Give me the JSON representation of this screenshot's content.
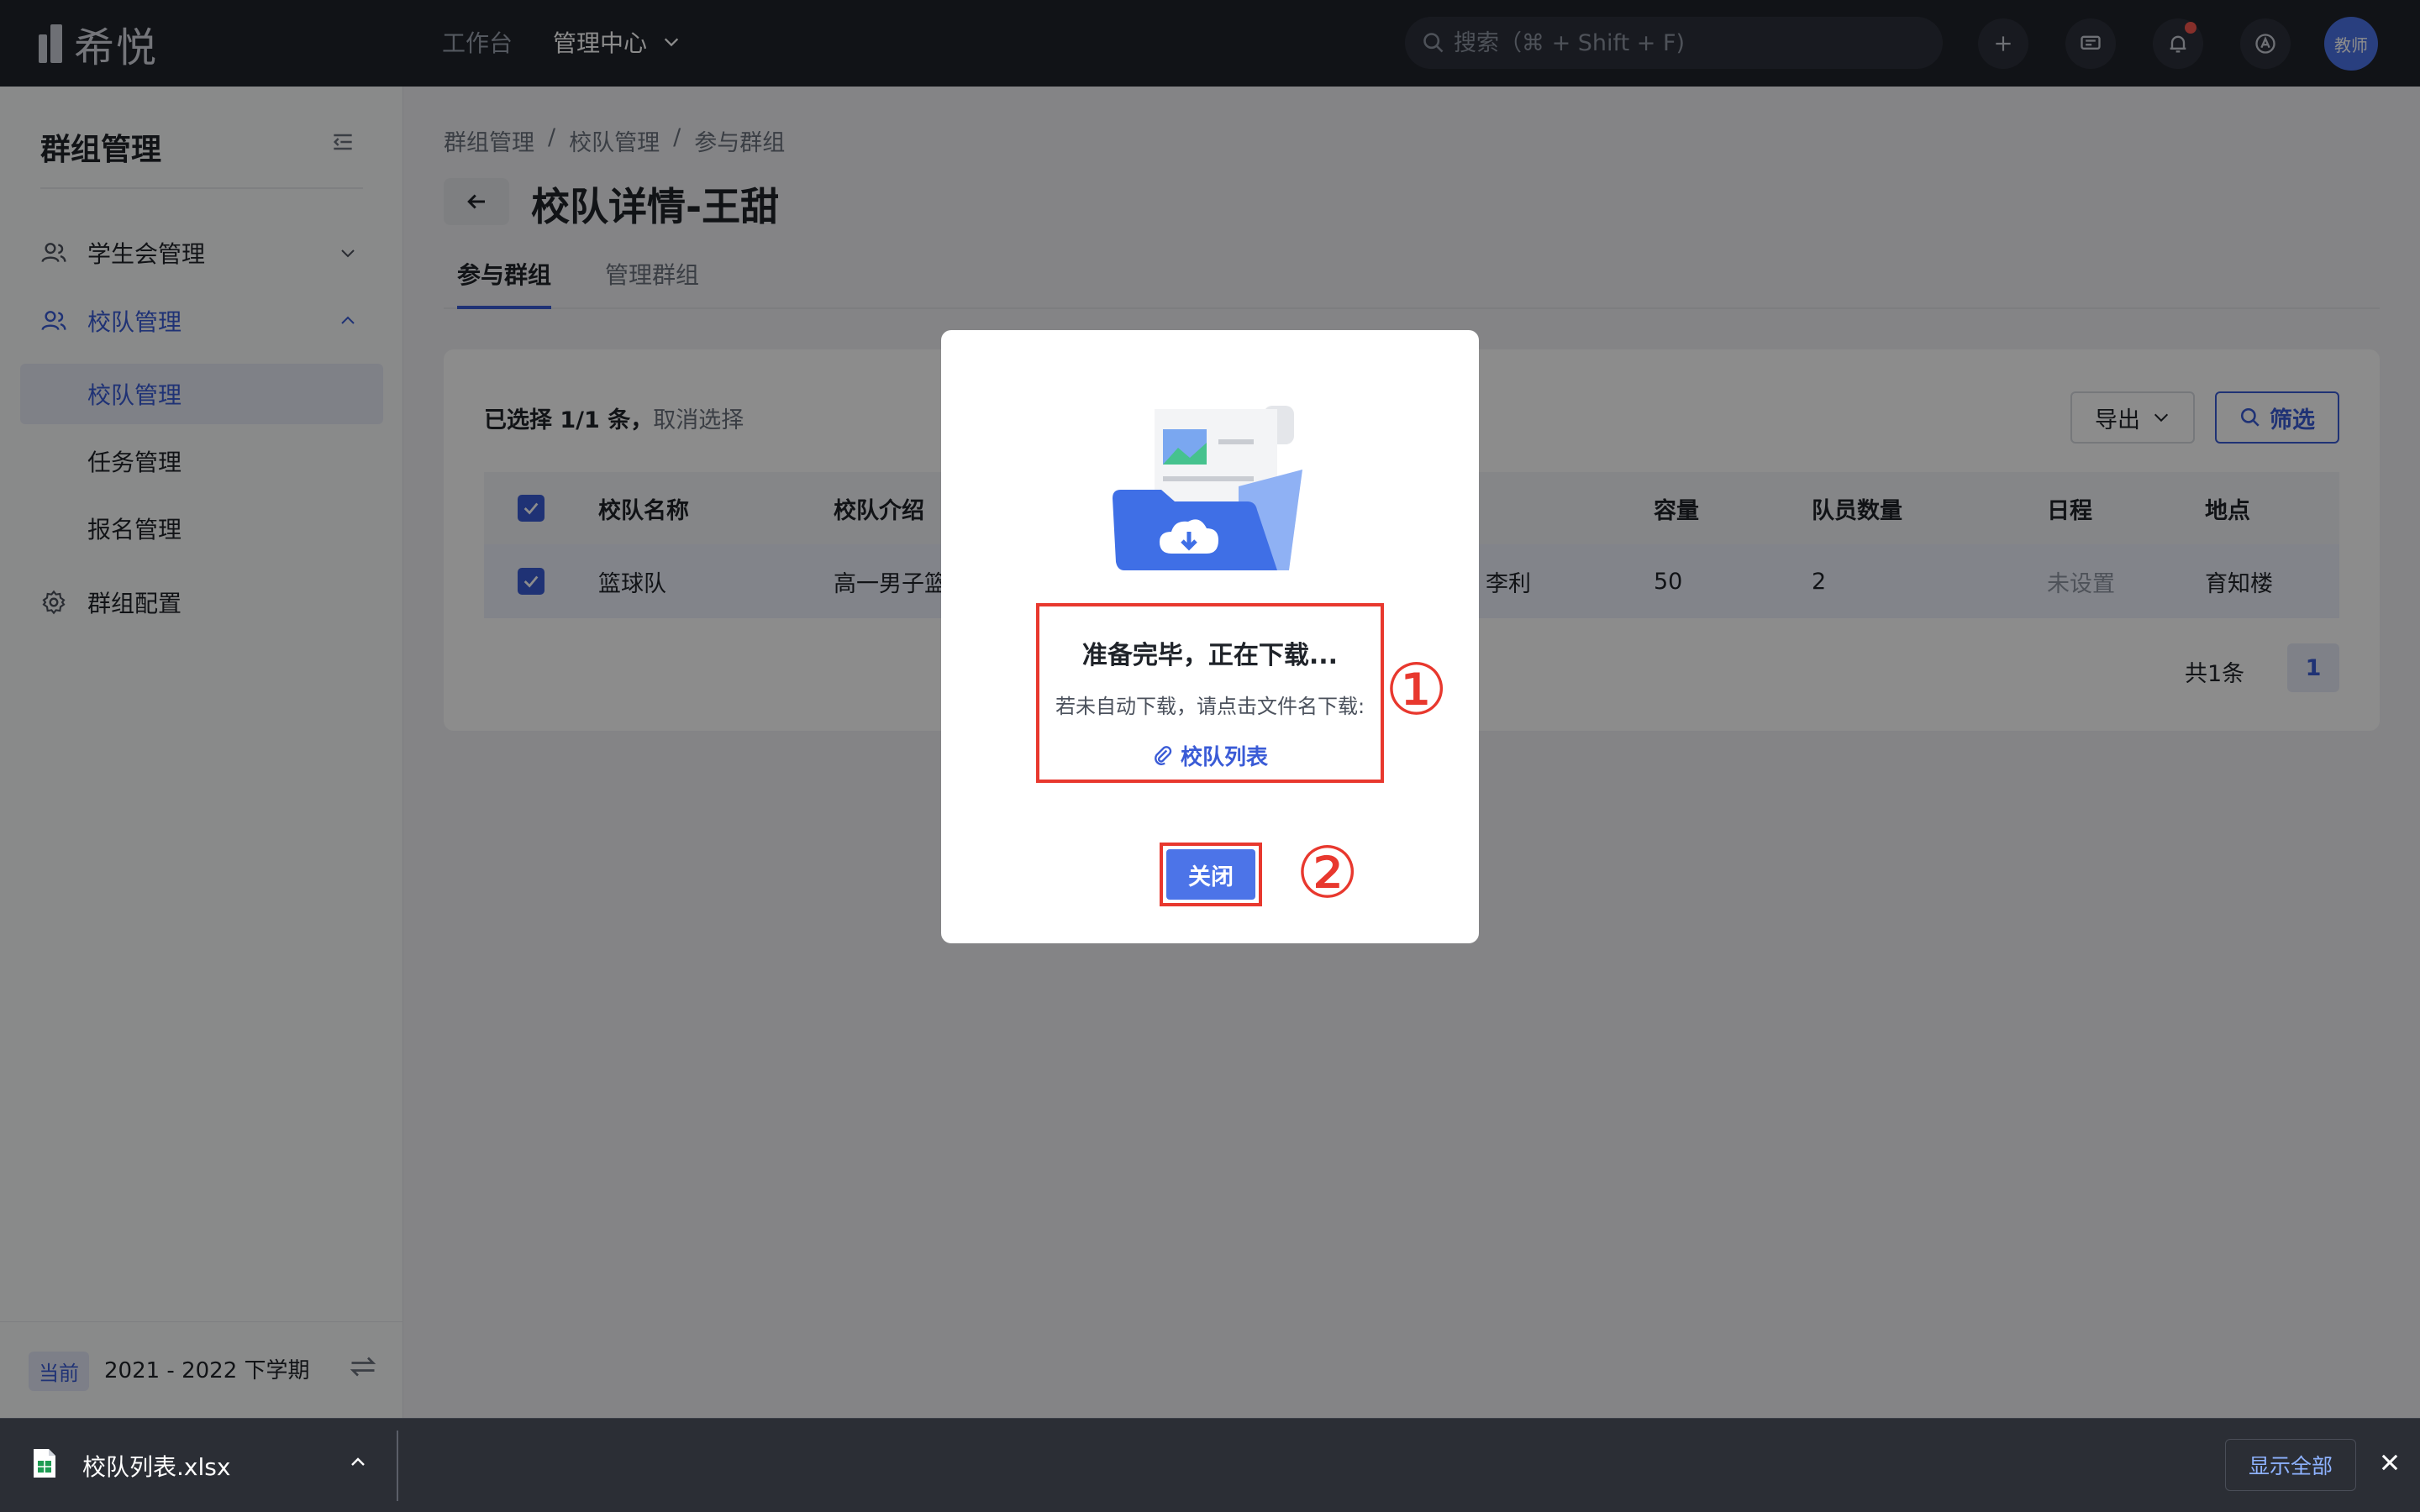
{
  "topbar": {
    "logo_text": "希悦",
    "nav": [
      {
        "label": "工作台"
      },
      {
        "label": "管理中心"
      }
    ],
    "search_placeholder": "搜索（⌘ + Shift + F)",
    "avatar_text": "教师",
    "icons": [
      "plus-icon",
      "message-icon",
      "bell-icon",
      "app-icon"
    ],
    "notification_dot_color": "#f5564e"
  },
  "sidebar": {
    "title": "群组管理",
    "groups": [
      {
        "label": "学生会管理",
        "expanded": false
      },
      {
        "label": "校队管理",
        "expanded": true
      },
      {
        "label": "群组配置"
      }
    ],
    "sub_items": [
      {
        "label": "校队管理",
        "active": true
      },
      {
        "label": "任务管理"
      },
      {
        "label": "报名管理"
      }
    ],
    "term_badge": "当前",
    "term_text": "2021 - 2022 下学期"
  },
  "main": {
    "breadcrumb": [
      "群组管理",
      "/",
      "校队管理",
      "/",
      "参与群组"
    ],
    "title": "校队详情-王甜",
    "tabs": [
      {
        "label": "参与群组",
        "active": true
      },
      {
        "label": "管理群组"
      }
    ],
    "selection_text": "已选择 1/1 条，",
    "cancel_selection": "取消选择",
    "export_label": "导出",
    "filter_label": "筛选",
    "table": {
      "headers": [
        "校队名称",
        "校队介绍",
        "容量",
        "队员数量",
        "日程",
        "地点"
      ],
      "rows": [
        {
          "name": "篮球队",
          "intro": "高一男子篮",
          "leader": "李利",
          "capacity": "50",
          "members": "2",
          "schedule": "未设置",
          "location": "育知楼"
        }
      ]
    },
    "total_text": "共1条",
    "page": "1"
  },
  "modal": {
    "title": "准备完毕，正在下载...",
    "subtitle": "若未自动下载，请点击文件名下载:",
    "file_link": "校队列表",
    "close_label": "关闭",
    "annotation_1": "①",
    "annotation_2": "②",
    "annotation_color": "#e8382e"
  },
  "download_bar": {
    "file_name": "校队列表.xlsx",
    "show_all": "显示全部"
  },
  "colors": {
    "accent": "#3a5bd6",
    "button_primary": "#4c74e8",
    "topbar_bg": "#20232b"
  }
}
